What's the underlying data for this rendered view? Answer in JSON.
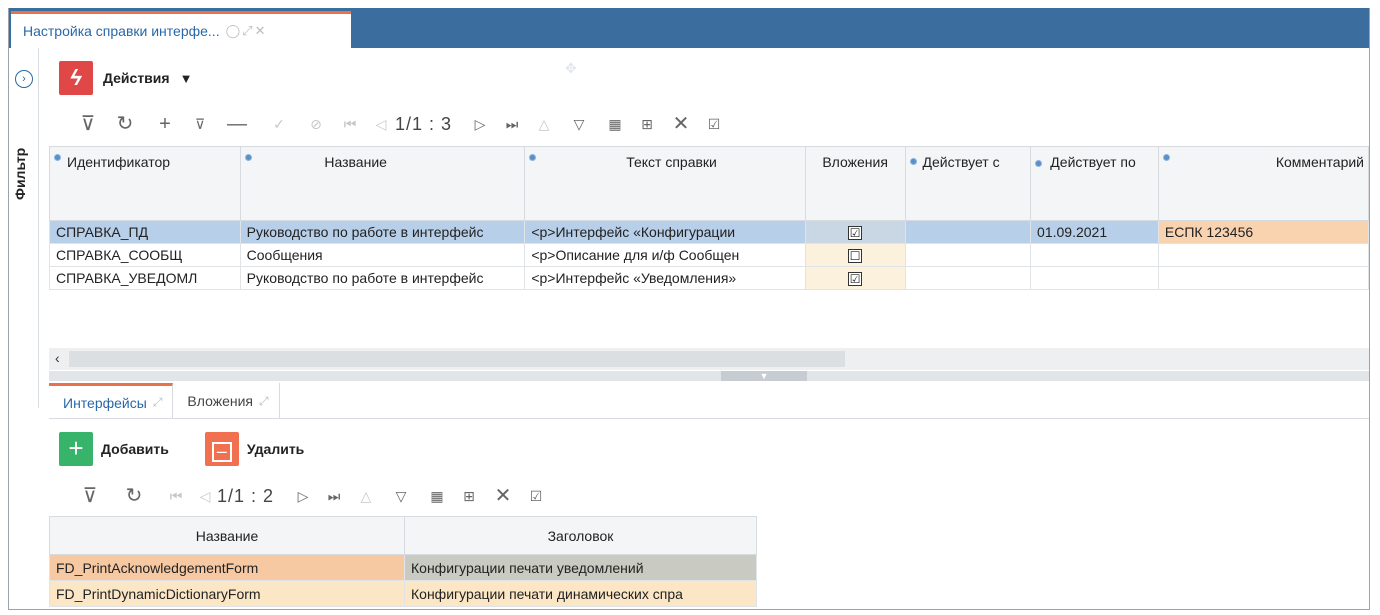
{
  "tab": {
    "title": "Настройка справки интерфе...",
    "refresh_icon": "refresh-icon",
    "expand_icon": "expand-icon",
    "close_icon": "close-icon"
  },
  "filter_panel": {
    "label": "Фильтр",
    "toggle_icon": "chevron-right-icon"
  },
  "actions": {
    "label": "Действия",
    "arrow": "▼"
  },
  "toolbar_main": {
    "pager": "1/1 : 3"
  },
  "grid": {
    "columns": [
      "Идентификатор",
      "Название",
      "Текст справки",
      "Вложения",
      "Действует с",
      "Действует по",
      "Комментарий"
    ],
    "rows": [
      {
        "id": "СПРАВКА_ПД",
        "name": "Руководство по работе в интерфейс",
        "text": "<p>Интерфейс «Конфигурации",
        "attach": "☑",
        "from": "",
        "to": "01.09.2021",
        "comment": "ЕСПК 123456",
        "selected": true
      },
      {
        "id": "СПРАВКА_СООБЩ",
        "name": "Сообщения",
        "text": "<p>Описание для и/ф Сообщен",
        "attach": "☐",
        "from": "",
        "to": "",
        "comment": "",
        "selected": false
      },
      {
        "id": "СПРАВКА_УВЕДОМЛ",
        "name": "Руководство по работе в интерфейс",
        "text": "<p>Интерфейс «Уведомления»",
        "attach": "☑",
        "from": "",
        "to": "",
        "comment": "",
        "selected": false
      }
    ]
  },
  "subtabs": [
    {
      "label": "Интерфейсы",
      "active": true
    },
    {
      "label": "Вложения",
      "active": false
    }
  ],
  "buttons": {
    "add_label": "Добавить",
    "delete_label": "Удалить"
  },
  "toolbar_sub": {
    "pager": "1/1 : 2"
  },
  "grid2": {
    "columns": [
      "Название",
      "Заголовок"
    ],
    "rows": [
      {
        "name": "FD_PrintAcknowledgementForm",
        "title": "Конфигурации печати уведомлений"
      },
      {
        "name": "FD_PrintDynamicDictionaryForm",
        "title": "Конфигурации печати динамических спра"
      }
    ]
  },
  "colors": {
    "accent": "#e8734a",
    "header_bar": "#3b6e9e",
    "link": "#2868a8",
    "selected_row": "#b7cfe8"
  }
}
